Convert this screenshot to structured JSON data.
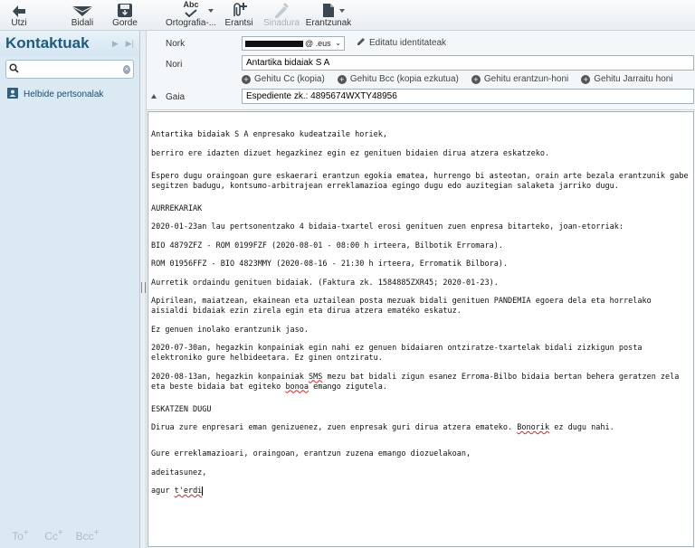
{
  "toolbar": {
    "utzi": "Utzi",
    "bidali": "Bidali",
    "gorde": "Gorde",
    "ortografia": "Ortografia-...",
    "erantsi": "Erantsi",
    "sinadura": "Sinadura",
    "erantzunak": "Erantzunak",
    "abc": "Abc"
  },
  "sidebar": {
    "title": "Kontaktuak",
    "search_placeholder": "",
    "item": "Helbide pertsonalak",
    "footer": {
      "to": "To",
      "cc": "Cc",
      "bcc": "Bcc",
      "plus": "+"
    }
  },
  "header": {
    "from_label": "Nork",
    "from_value": "@ .eus",
    "edit_identities": "Editatu identitateak",
    "to_label": "Nori",
    "to_value": "Antartika bidaiak S A",
    "add_cc": "Gehitu Cc (kopia)",
    "add_bcc": "Gehitu Bcc (kopia ezkutua)",
    "add_reply": "Gehitu erantzun-honi",
    "add_followup": "Gehitu Jarraitu honi",
    "subject_label": "Gaia",
    "subject_value": "Espediente zk.: 4895674WXTY48956"
  },
  "body": {
    "p1": "Antartika bidaiak S A enpresako kudeatzaile horiek,",
    "p2": "berriro ere idazten dizuet hegazkinez egin ez genituen bidaien dirua atzera eskatzeko.",
    "p3": "Espero dugu oraingoan gure eskaerari erantzun egokia ematea, hurrengo bi asteotan, orain arte bezala erantzunik gabe segitzen badugu, kontsumo-arbitrajean erreklamazioa egingo dugu edo auzitegian salaketa jarriko dugu.",
    "p4": "AURREKARIAK",
    "p5": "2020-01-23an lau pertsonentzako 4 bidaia-txartel erosi genituen zuen enpresa bitarteko, joan-etorriak:",
    "p6": "BIO 4879ZFZ - ROM 0199FZF (2020-08-01 - 08:00 h irteera, Bilbotik Erromara).",
    "p7": "ROM 01956FFZ - BIO 4823MMY (2020-08-16 - 21:30 h irteera, Erromatik Bilbora).",
    "p8": "Aurretik ordaindu genituen bidaiak. (Faktura zk. 1584885ZXR45; 2020-01-23).",
    "p9": "Apirilean, maiatzean, ekainean eta uztailean posta mezuak bidali genituen PANDEMIA egoera dela eta horrelako aisialdi bidaiak ezin zirela egin eta dirua atzera ematéko eskatuz.",
    "p10": "Ez genuen inolako erantzunik jaso.",
    "p11": "2020-07-30an, hegazkin konpainiak egin nahi ez genuen bidaiaren ontziratze-txartelak bidali zizkigun posta elektroniko gure helbideetara. Ez ginen ontziratu.",
    "p12a": "2020-08-13an, hegazkin konpainiak ",
    "p12b": "SMS",
    "p12c": " mezu bat bidali zigun esanez Erroma-Bilbo bidaia bertan behera geratzen zela eta beste bidaia bat egiteko ",
    "p12d": "bonoa",
    "p12e": " emango zigutela.",
    "p13": "ESKATZEN DUGU",
    "p14a": "Dirua zure enpresari eman genizuenez, zuen enpresak guri dirua atzera emateko. ",
    "p14b": "Bonorik",
    "p14c": " ez dugu nahi.",
    "p15": "Gure erreklamazioari, oraingoan, erantzun zuzena emango diozuelakoan,",
    "p16": "adeitasunez,",
    "p17a": "agur ",
    "p17b": "t'erdi"
  }
}
